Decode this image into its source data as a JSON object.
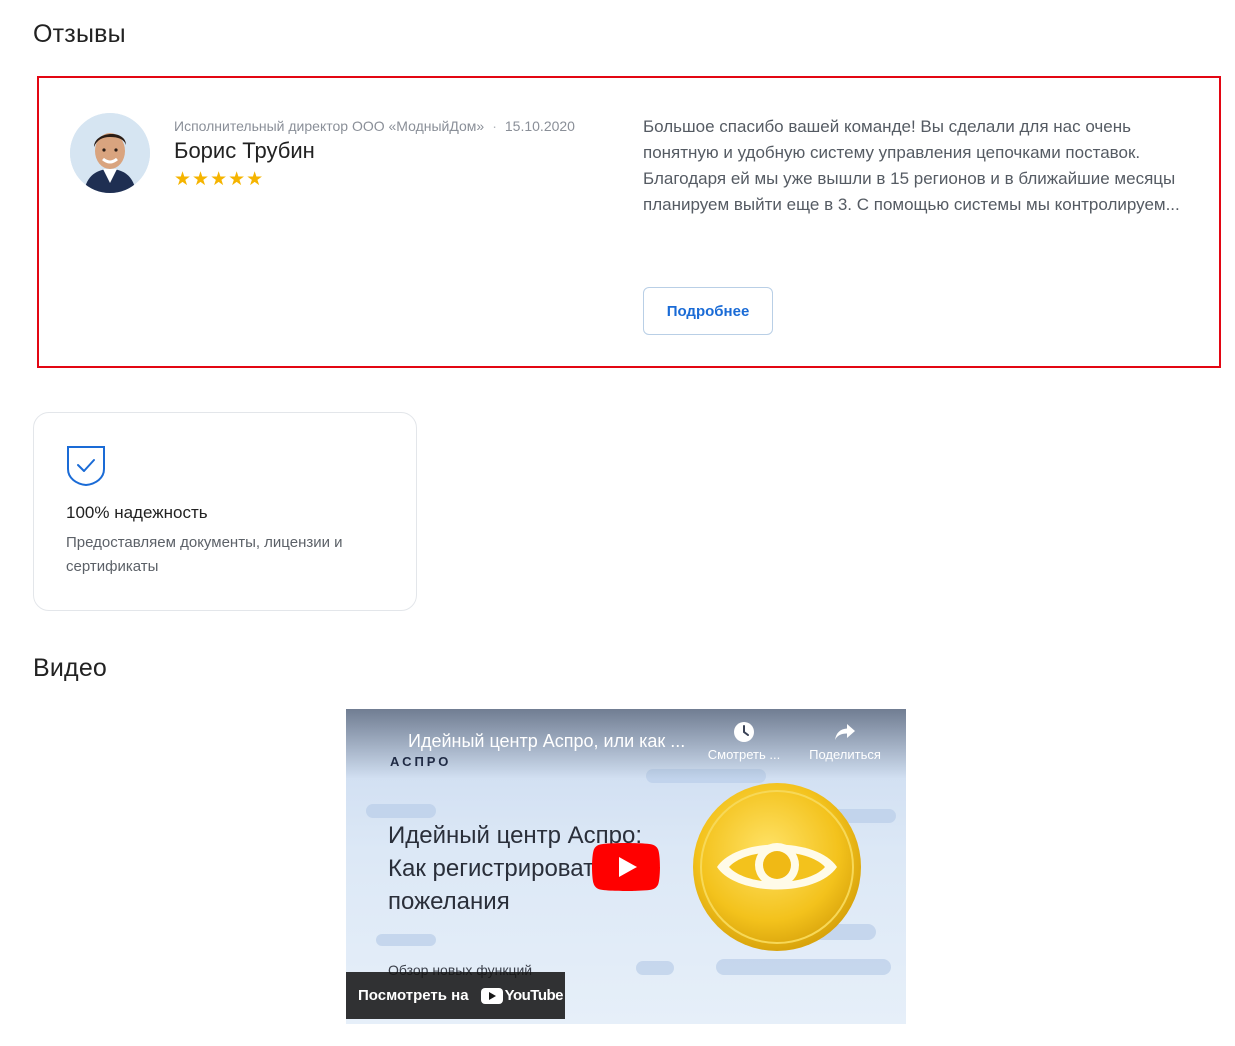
{
  "reviews": {
    "title": "Отзывы",
    "item": {
      "position": "Исполнительный директор ООО «МодныйДом»",
      "date": "15.10.2020",
      "name": "Борис Трубин",
      "rating": 5,
      "stars": "★★★★★",
      "text": "Большое спасибо вашей команде! Вы сделали для нас очень понятную и удобную систему управления цепочками поставок. Благодаря ей мы уже вышли в 15 регионов и в ближайшие месяцы планируем выйти еще в 3. С помощью системы мы контролируем...",
      "more_label": "Подробнее"
    },
    "highlight_color": "#e30613"
  },
  "feature": {
    "icon": "shield-check-icon",
    "title": "100% надежность",
    "description": "Предоставляем документы, лицензии и сертификаты",
    "accent": "#1a6bd6"
  },
  "video": {
    "title": "Видео",
    "player": {
      "video_title": "Идейный центр Аспро, или как ...",
      "brand": "АСПРО",
      "watch_later_label": "Смотреть ...",
      "share_label": "Поделиться",
      "heading_line1": "Идейный центр Аспро:",
      "heading_line2": "Как регистрировать",
      "heading_line3": "пожелания",
      "subheading": "Обзор новых функций",
      "watch_on_label": "Посмотреть на",
      "youtube_label": "YouTube",
      "play_color": "#ff0000"
    }
  }
}
